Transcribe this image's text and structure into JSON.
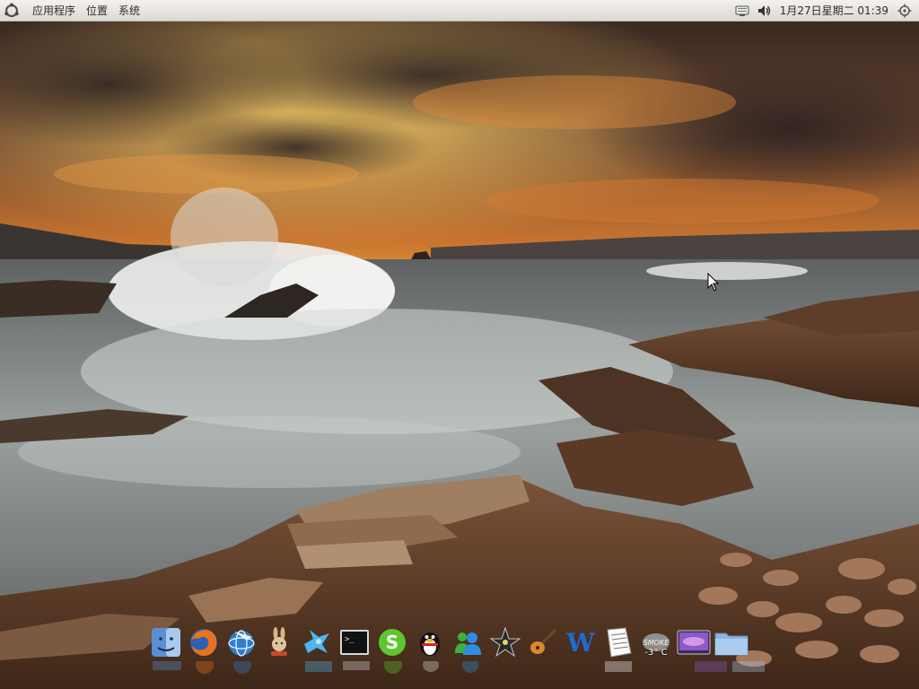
{
  "panel": {
    "menus": [
      "应用程序",
      "位置",
      "系统"
    ],
    "clock": "1月27日星期二 01:39",
    "tray_icons": [
      "network-icon",
      "volume-icon",
      "settings-icon"
    ]
  },
  "wallpaper": {
    "description_colors": {
      "sky_top": "#3b2a22",
      "sunset": "#f0a63a",
      "sea": "#8a8f8e",
      "rocks": "#5a3b28"
    }
  },
  "dock": {
    "items": [
      {
        "name": "finder-icon"
      },
      {
        "name": "firefox-icon"
      },
      {
        "name": "globe-app-icon"
      },
      {
        "name": "rabbit-app-icon"
      },
      {
        "name": "bird-app-icon"
      },
      {
        "name": "terminal-icon"
      },
      {
        "name": "skype-icon"
      },
      {
        "name": "qq-penguin-icon"
      },
      {
        "name": "messenger-icon"
      },
      {
        "name": "imovie-star-icon"
      },
      {
        "name": "guitar-icon"
      },
      {
        "name": "wordpress-w-icon"
      },
      {
        "name": "text-document-icon"
      },
      {
        "name": "weather-icon"
      },
      {
        "name": "desktop-preview-icon"
      },
      {
        "name": "folder-icon"
      }
    ],
    "weather_text": "-3° C",
    "weather_caption": "SMOKE"
  }
}
